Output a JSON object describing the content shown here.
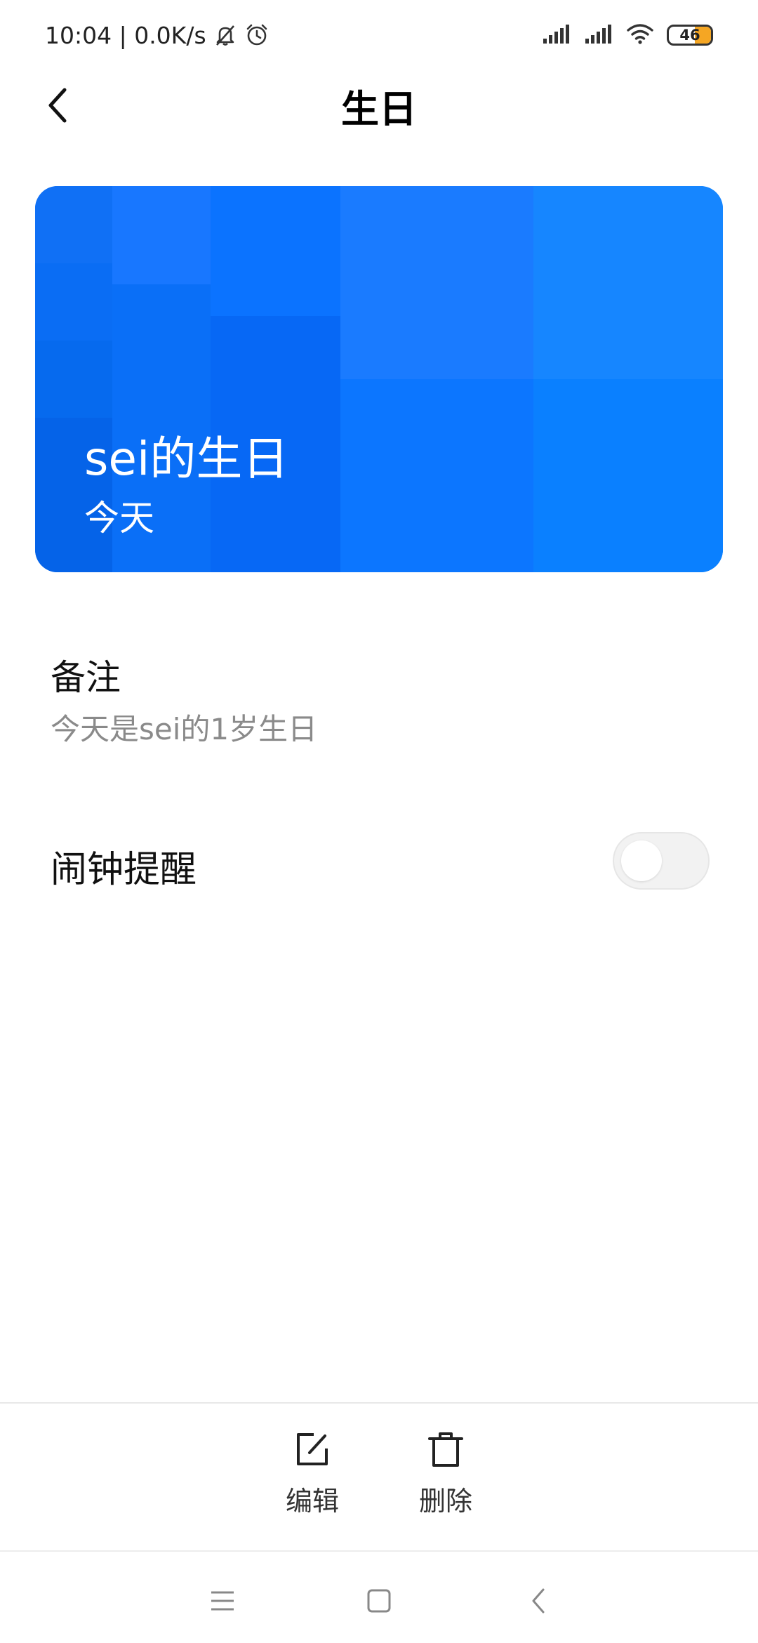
{
  "status_bar": {
    "time_speed": "10:04 | 0.0K/s",
    "battery": "46",
    "icons": [
      "mute-bell-icon",
      "alarm-clock-icon",
      "signal-icon",
      "signal-icon",
      "wifi-icon",
      "battery-icon"
    ]
  },
  "header": {
    "title": "生日",
    "back_icon": "chevron-left-icon"
  },
  "card": {
    "title": "sei的生日",
    "subtitle": "今天",
    "accent_color": "#0a7aff"
  },
  "note": {
    "label": "备注",
    "text": "今天是sei的1岁生日"
  },
  "alarm": {
    "label": "闹钟提醒",
    "enabled": false
  },
  "actions": {
    "edit_label": "编辑",
    "delete_label": "删除",
    "edit_icon": "edit-icon",
    "delete_icon": "trash-icon"
  },
  "nav": {
    "icons": [
      "menu-icon",
      "home-square-icon",
      "back-icon"
    ]
  }
}
